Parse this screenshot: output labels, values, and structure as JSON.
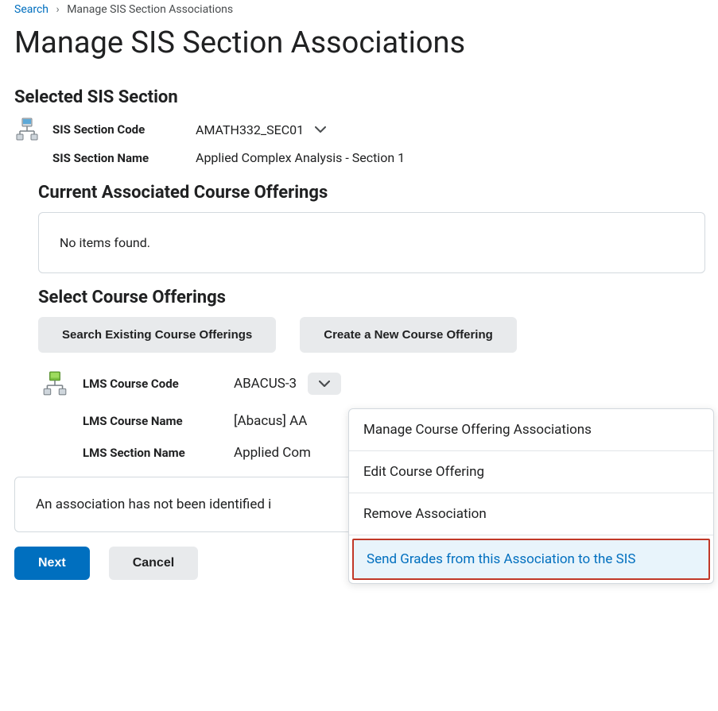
{
  "breadcrumb": {
    "link": "Search",
    "current": "Manage SIS Section Associations"
  },
  "page_title": "Manage SIS Section Associations",
  "selected_section": {
    "heading": "Selected SIS Section",
    "code_label": "SIS Section Code",
    "code_value": "AMATH332_SEC01",
    "name_label": "SIS Section Name",
    "name_value": "Applied Complex Analysis - Section 1"
  },
  "current_offerings": {
    "heading": "Current Associated Course Offerings",
    "empty_text": "No items found."
  },
  "select_offerings": {
    "heading": "Select Course Offerings",
    "search_btn": "Search Existing Course Offerings",
    "create_btn": "Create a New Course Offering",
    "code_label": "LMS Course Code",
    "code_value": "ABACUS-3",
    "name_label": "LMS Course Name",
    "name_value": "[Abacus] AA",
    "section_label": "LMS Section Name",
    "section_value": "Applied Com"
  },
  "dropdown": {
    "item1": "Manage Course Offering Associations",
    "item2": "Edit Course Offering",
    "item3": "Remove Association",
    "item4": "Send Grades from this Association to the SIS"
  },
  "warning": "An association has not been identified i",
  "footer": {
    "next": "Next",
    "cancel": "Cancel"
  }
}
